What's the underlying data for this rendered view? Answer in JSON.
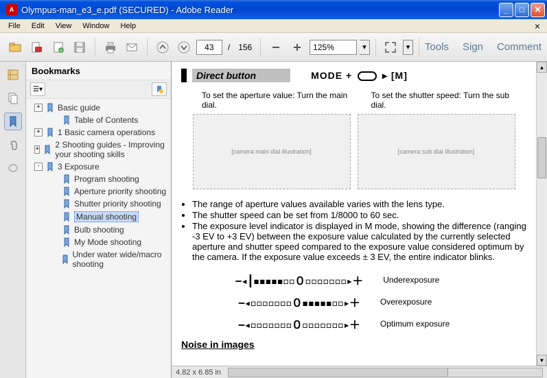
{
  "window": {
    "title": "Olympus-man_e3_e.pdf (SECURED) - Adobe Reader",
    "app_icon_text": "A"
  },
  "menu": {
    "file": "File",
    "edit": "Edit",
    "view": "View",
    "window": "Window",
    "help": "Help"
  },
  "toolbar": {
    "page_current": "43",
    "page_sep": "/",
    "page_total": "156",
    "zoom": "125%",
    "tools": "Tools",
    "sign": "Sign",
    "comment": "Comment"
  },
  "bookmarks": {
    "title": "Bookmarks",
    "items": [
      {
        "label": "Basic guide",
        "indent": 1,
        "expand": "+",
        "selected": false
      },
      {
        "label": "Table of Contents",
        "indent": 2,
        "expand": "",
        "selected": false
      },
      {
        "label": "1 Basic camera operations",
        "indent": 1,
        "expand": "+",
        "selected": false
      },
      {
        "label": "2 Shooting guides - Improving your shooting skills",
        "indent": 1,
        "expand": "+",
        "selected": false
      },
      {
        "label": "3 Exposure",
        "indent": 1,
        "expand": "-",
        "selected": false
      },
      {
        "label": "Program shooting",
        "indent": 2,
        "expand": "",
        "selected": false
      },
      {
        "label": "Aperture priority shooting",
        "indent": 2,
        "expand": "",
        "selected": false
      },
      {
        "label": "Shutter priority shooting",
        "indent": 2,
        "expand": "",
        "selected": false
      },
      {
        "label": "Manual shooting",
        "indent": 2,
        "expand": "",
        "selected": true
      },
      {
        "label": "Bulb shooting",
        "indent": 2,
        "expand": "",
        "selected": false
      },
      {
        "label": "My Mode shooting",
        "indent": 2,
        "expand": "",
        "selected": false
      },
      {
        "label": "Under water wide/macro shooting",
        "indent": 2,
        "expand": "",
        "selected": false
      }
    ]
  },
  "doc": {
    "direct_button": "Direct button",
    "mode_prefix": "MODE + ",
    "mode_suffix": " ▸ [M]",
    "instr_left": "To set the aperture value: Turn the main dial.",
    "instr_right": "To set the shutter speed: Turn the sub dial.",
    "illustration_left": "[camera main dial illustration]",
    "illustration_right": "[camera sub dial illustration]",
    "bullet1": "The range of aperture values available varies with the lens type.",
    "bullet2": "The shutter speed can be set from 1/8000 to 60 sec.",
    "bullet3": "The exposure level indicator is displayed in M mode, showing the difference (ranging -3 EV to +3 EV) between the exposure value calculated by the currently selected aperture and shutter speed compared to the exposure value considered optimum by the camera. If the exposure value exceeds ± 3 EV, the entire indicator blinks.",
    "exposure1_label": "Underexposure",
    "exposure2_label": "Overexposure",
    "exposure3_label": "Optimum exposure",
    "scale1": "−◂┃▪▪▪▪▪▫▫０▫▫▫▫▫▫▫▸＋",
    "scale2": "−◂▫▫▫▫▫▫▫０▪▪▪▪▪▫▫▸＋",
    "scale3": "−◂▫▫▫▫▫▫▫０▫▫▫▫▫▫▫▸＋",
    "noise": "Noise in images",
    "pagesize": "4.82 x 6.85 in"
  }
}
